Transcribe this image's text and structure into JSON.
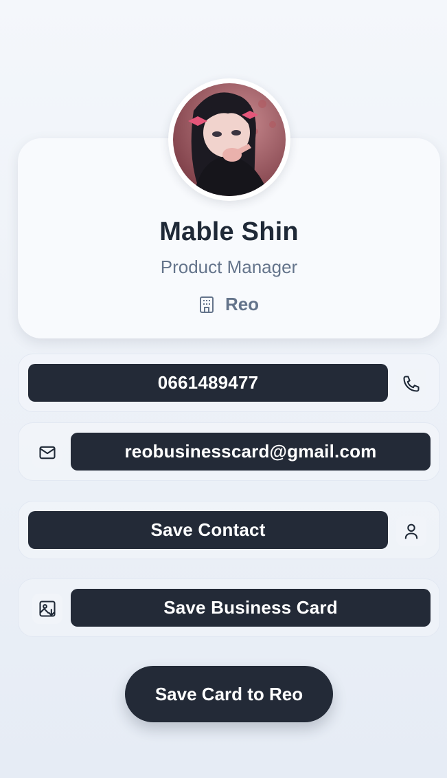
{
  "profile": {
    "name": "Mable Shin",
    "role": "Product Manager",
    "company": "Reo",
    "avatar_icon": "avatar-illustration"
  },
  "actions": {
    "phone": {
      "label": "0661489477",
      "icon": "phone-icon"
    },
    "email": {
      "label": "reobusinesscard@gmail.com",
      "icon": "mail-icon"
    },
    "save_contact": {
      "label": "Save Contact",
      "icon": "user-icon"
    },
    "save_business_card": {
      "label": "Save Business Card",
      "icon": "image-download-icon"
    },
    "save_to_reo": {
      "label": "Save Card to Reo"
    }
  },
  "colors": {
    "button_dark": "#232a37",
    "text_primary": "#1f2937",
    "text_muted": "#64748b",
    "background": "#eef2f8"
  }
}
